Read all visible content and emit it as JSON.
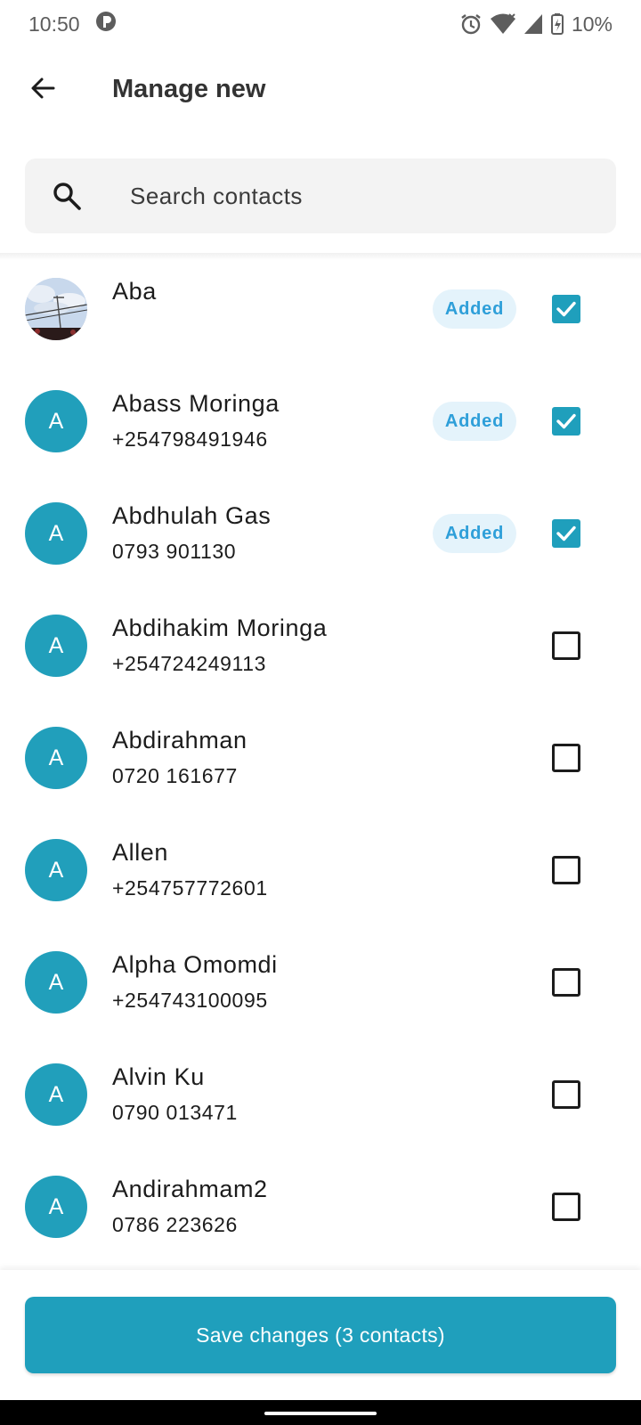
{
  "status_bar": {
    "time": "10:50",
    "battery": "10%",
    "icons": [
      "media-icon",
      "alarm-icon",
      "wifi-icon",
      "signal-icon",
      "battery-charging-icon"
    ]
  },
  "app_bar": {
    "title": "Manage new",
    "back_icon": "arrow-left-icon"
  },
  "search": {
    "placeholder": "Search contacts",
    "value": "",
    "icon": "search-icon"
  },
  "contacts": [
    {
      "initial": "",
      "has_photo": true,
      "name": "Aba",
      "phone": "",
      "added": true,
      "badge": "Added",
      "checked": true
    },
    {
      "initial": "A",
      "has_photo": false,
      "name": "Abass Moringa",
      "phone": "+254798491946",
      "added": true,
      "badge": "Added",
      "checked": true
    },
    {
      "initial": "A",
      "has_photo": false,
      "name": "Abdhulah Gas",
      "phone": "0793 901130",
      "added": true,
      "badge": "Added",
      "checked": true
    },
    {
      "initial": "A",
      "has_photo": false,
      "name": "Abdihakim Moringa",
      "phone": "+254724249113",
      "added": false,
      "badge": "",
      "checked": false
    },
    {
      "initial": "A",
      "has_photo": false,
      "name": "Abdirahman",
      "phone": "0720 161677",
      "added": false,
      "badge": "",
      "checked": false
    },
    {
      "initial": "A",
      "has_photo": false,
      "name": "Allen",
      "phone": "+254757772601",
      "added": false,
      "badge": "",
      "checked": false
    },
    {
      "initial": "A",
      "has_photo": false,
      "name": "Alpha Omomdi",
      "phone": "+254743100095",
      "added": false,
      "badge": "",
      "checked": false
    },
    {
      "initial": "A",
      "has_photo": false,
      "name": "Alvin Ku",
      "phone": "0790 013471",
      "added": false,
      "badge": "",
      "checked": false
    },
    {
      "initial": "A",
      "has_photo": false,
      "name": "Andirahmam2",
      "phone": "0786 223626",
      "added": false,
      "badge": "",
      "checked": false
    }
  ],
  "footer": {
    "save_label": "Save changes (3 contacts)"
  },
  "colors": {
    "accent": "#1f9fbc",
    "avatar_bg": "#219fbb",
    "badge_bg": "#e4f3fb",
    "badge_text": "#2e9fd9",
    "search_bg": "#f3f3f3"
  }
}
